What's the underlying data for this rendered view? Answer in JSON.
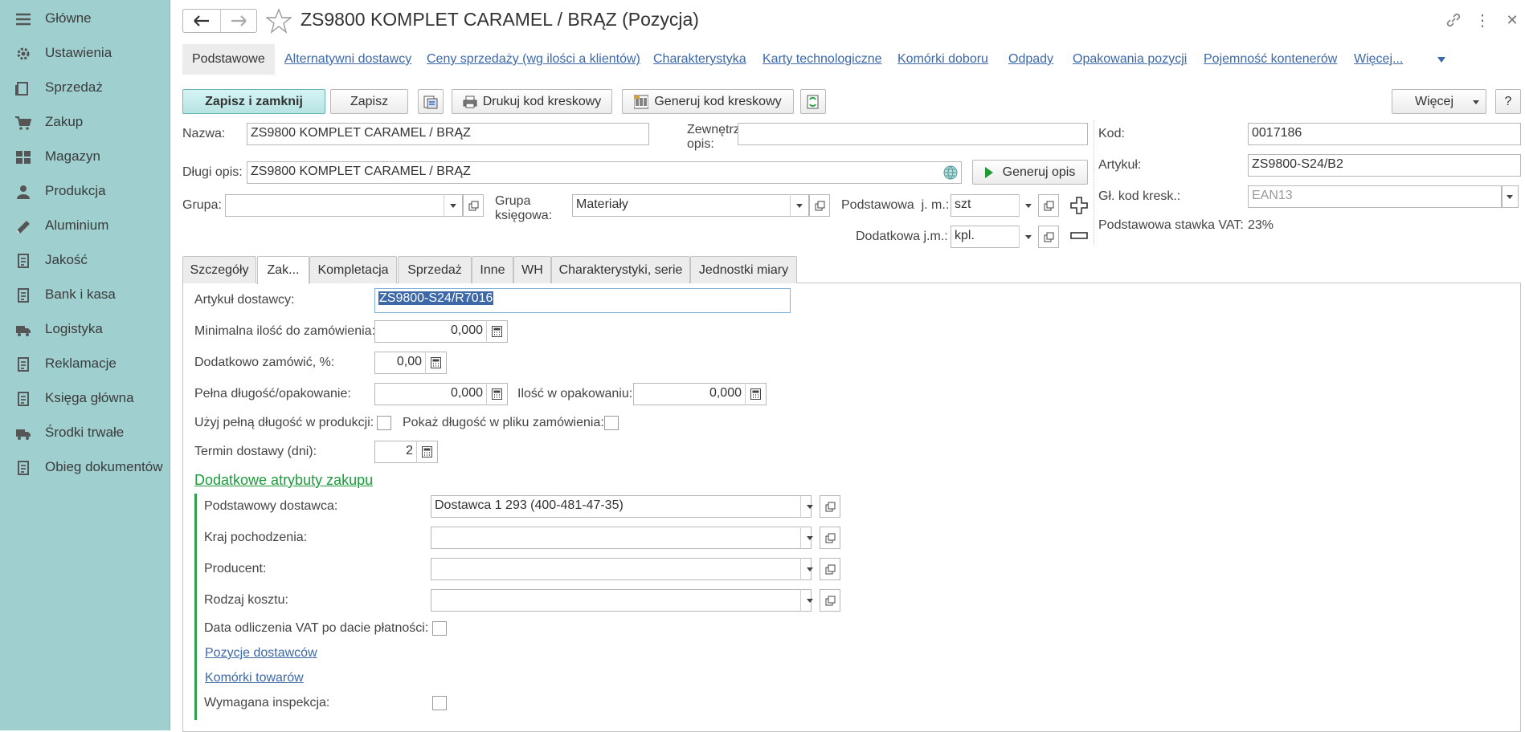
{
  "sidebar": {
    "items": [
      {
        "label": "Główne",
        "icon": "menu-icon"
      },
      {
        "label": "Ustawienia",
        "icon": "gear-icon"
      },
      {
        "label": "Sprzedaż",
        "icon": "sales-icon"
      },
      {
        "label": "Zakup",
        "icon": "cart-icon"
      },
      {
        "label": "Magazyn",
        "icon": "warehouse-icon"
      },
      {
        "label": "Produkcja",
        "icon": "production-icon"
      },
      {
        "label": "Aluminium",
        "icon": "aluminium-icon"
      },
      {
        "label": "Jakość",
        "icon": "quality-icon"
      },
      {
        "label": "Bank i kasa",
        "icon": "bank-icon"
      },
      {
        "label": "Logistyka",
        "icon": "truck-icon"
      },
      {
        "label": "Reklamacje",
        "icon": "complaints-icon"
      },
      {
        "label": "Księga główna",
        "icon": "ledger-icon"
      },
      {
        "label": "Środki trwałe",
        "icon": "assets-icon"
      },
      {
        "label": "Obieg dokumentów",
        "icon": "documents-icon"
      }
    ]
  },
  "header": {
    "title": "ZS9800 KOMPLET CARAMEL / BRĄZ (Pozycja)",
    "back_glyph": "←",
    "forward_glyph": "→",
    "more_glyph": "⋮",
    "close_glyph": "✕"
  },
  "links": {
    "items": [
      "Podstawowe",
      "Alternatywni dostawcy",
      "Ceny sprzedaży (wg ilości a klientów)",
      "Charakterystyka",
      "Karty technologiczne",
      "Komórki doboru",
      "Odpady",
      "Opakowania pozycji",
      "Pojemność kontenerów",
      "Więcej..."
    ]
  },
  "toolbar": {
    "save_close": "Zapisz i zamknij",
    "save": "Zapisz",
    "print_barcode": "Drukuj kod kreskowy",
    "gen_barcode": "Generuj kod kreskowy",
    "more": "Więcej",
    "help": "?"
  },
  "form": {
    "nazwa_label": "Nazwa:",
    "nazwa_value": "ZS9800 KOMPLET CARAMEL / BRĄZ",
    "zewn_label_1": "Zewnętrzny",
    "zewn_label_2": "opis:",
    "zewn_value": "",
    "dlugi_label": "Długi opis:",
    "dlugi_value": "ZS9800 KOMPLET CARAMEL / BRĄZ",
    "generuj_opis": "Generuj opis",
    "grupa_label": "Grupa:",
    "grupa_value": "",
    "grupa_ks_label_1": "Grupa",
    "grupa_ks_label_2": "księgowa:",
    "grupa_ks_value": "Materiały",
    "podst_jm_label": "Podstawowa  j. m.:",
    "podst_jm_value": "szt",
    "dod_jm_label": "Dodatkowa j.m.:",
    "dod_jm_value": "kpl.",
    "kod_label": "Kod:",
    "kod_value": "0017186",
    "artykul_label": "Artykuł:",
    "artykul_value": "ZS9800-S24/B2",
    "glkod_label": "Gł. kod kresk.:",
    "glkod_placeholder": "EAN13",
    "vat_label": "Podstawowa stawka VAT:",
    "vat_value": "23%"
  },
  "tabs": [
    "Szczegóły",
    "Zak...",
    "Kompletacja",
    "Sprzedaż",
    "Inne",
    "WH",
    "Charakterystyki, serie",
    "Jednostki miary"
  ],
  "zakup": {
    "art_dost_label": "Artykuł dostawcy:",
    "art_dost_value": "ZS9800-S24/R7016",
    "min_ilosc_label": "Minimalna ilość do zamówienia:",
    "min_ilosc_value": "0,000",
    "dodatkowo_label": "Dodatkowo zamówić, %:",
    "dodatkowo_value": "0,00",
    "pelna_label": "Pełna długość/opakowanie:",
    "pelna_value": "0,000",
    "ilosc_opak_label": "Ilość w opakowaniu:",
    "ilosc_opak_value": "0,000",
    "uzyj_label": "Użyj pełną długość w produkcji:",
    "pokaz_label": "Pokaż długość w pliku zamówienia:",
    "termin_label": "Termin dostawy (dni):",
    "termin_value": "2",
    "section_title": "Dodatkowe atrybuty zakupu",
    "podst_dost_label": "Podstawowy dostawca:",
    "podst_dost_value": "Dostawca 1 293 (400-481-47-35)",
    "kraj_label": "Kraj pochodzenia:",
    "producent_label": "Producent:",
    "rodzaj_label": "Rodzaj kosztu:",
    "data_vat_label": "Data odliczenia VAT po dacie płatności:",
    "pozycje_link": "Pozycje dostawców",
    "komorki_link": "Komórki towarów",
    "inspekcja_label": "Wymagana inspekcja:"
  }
}
